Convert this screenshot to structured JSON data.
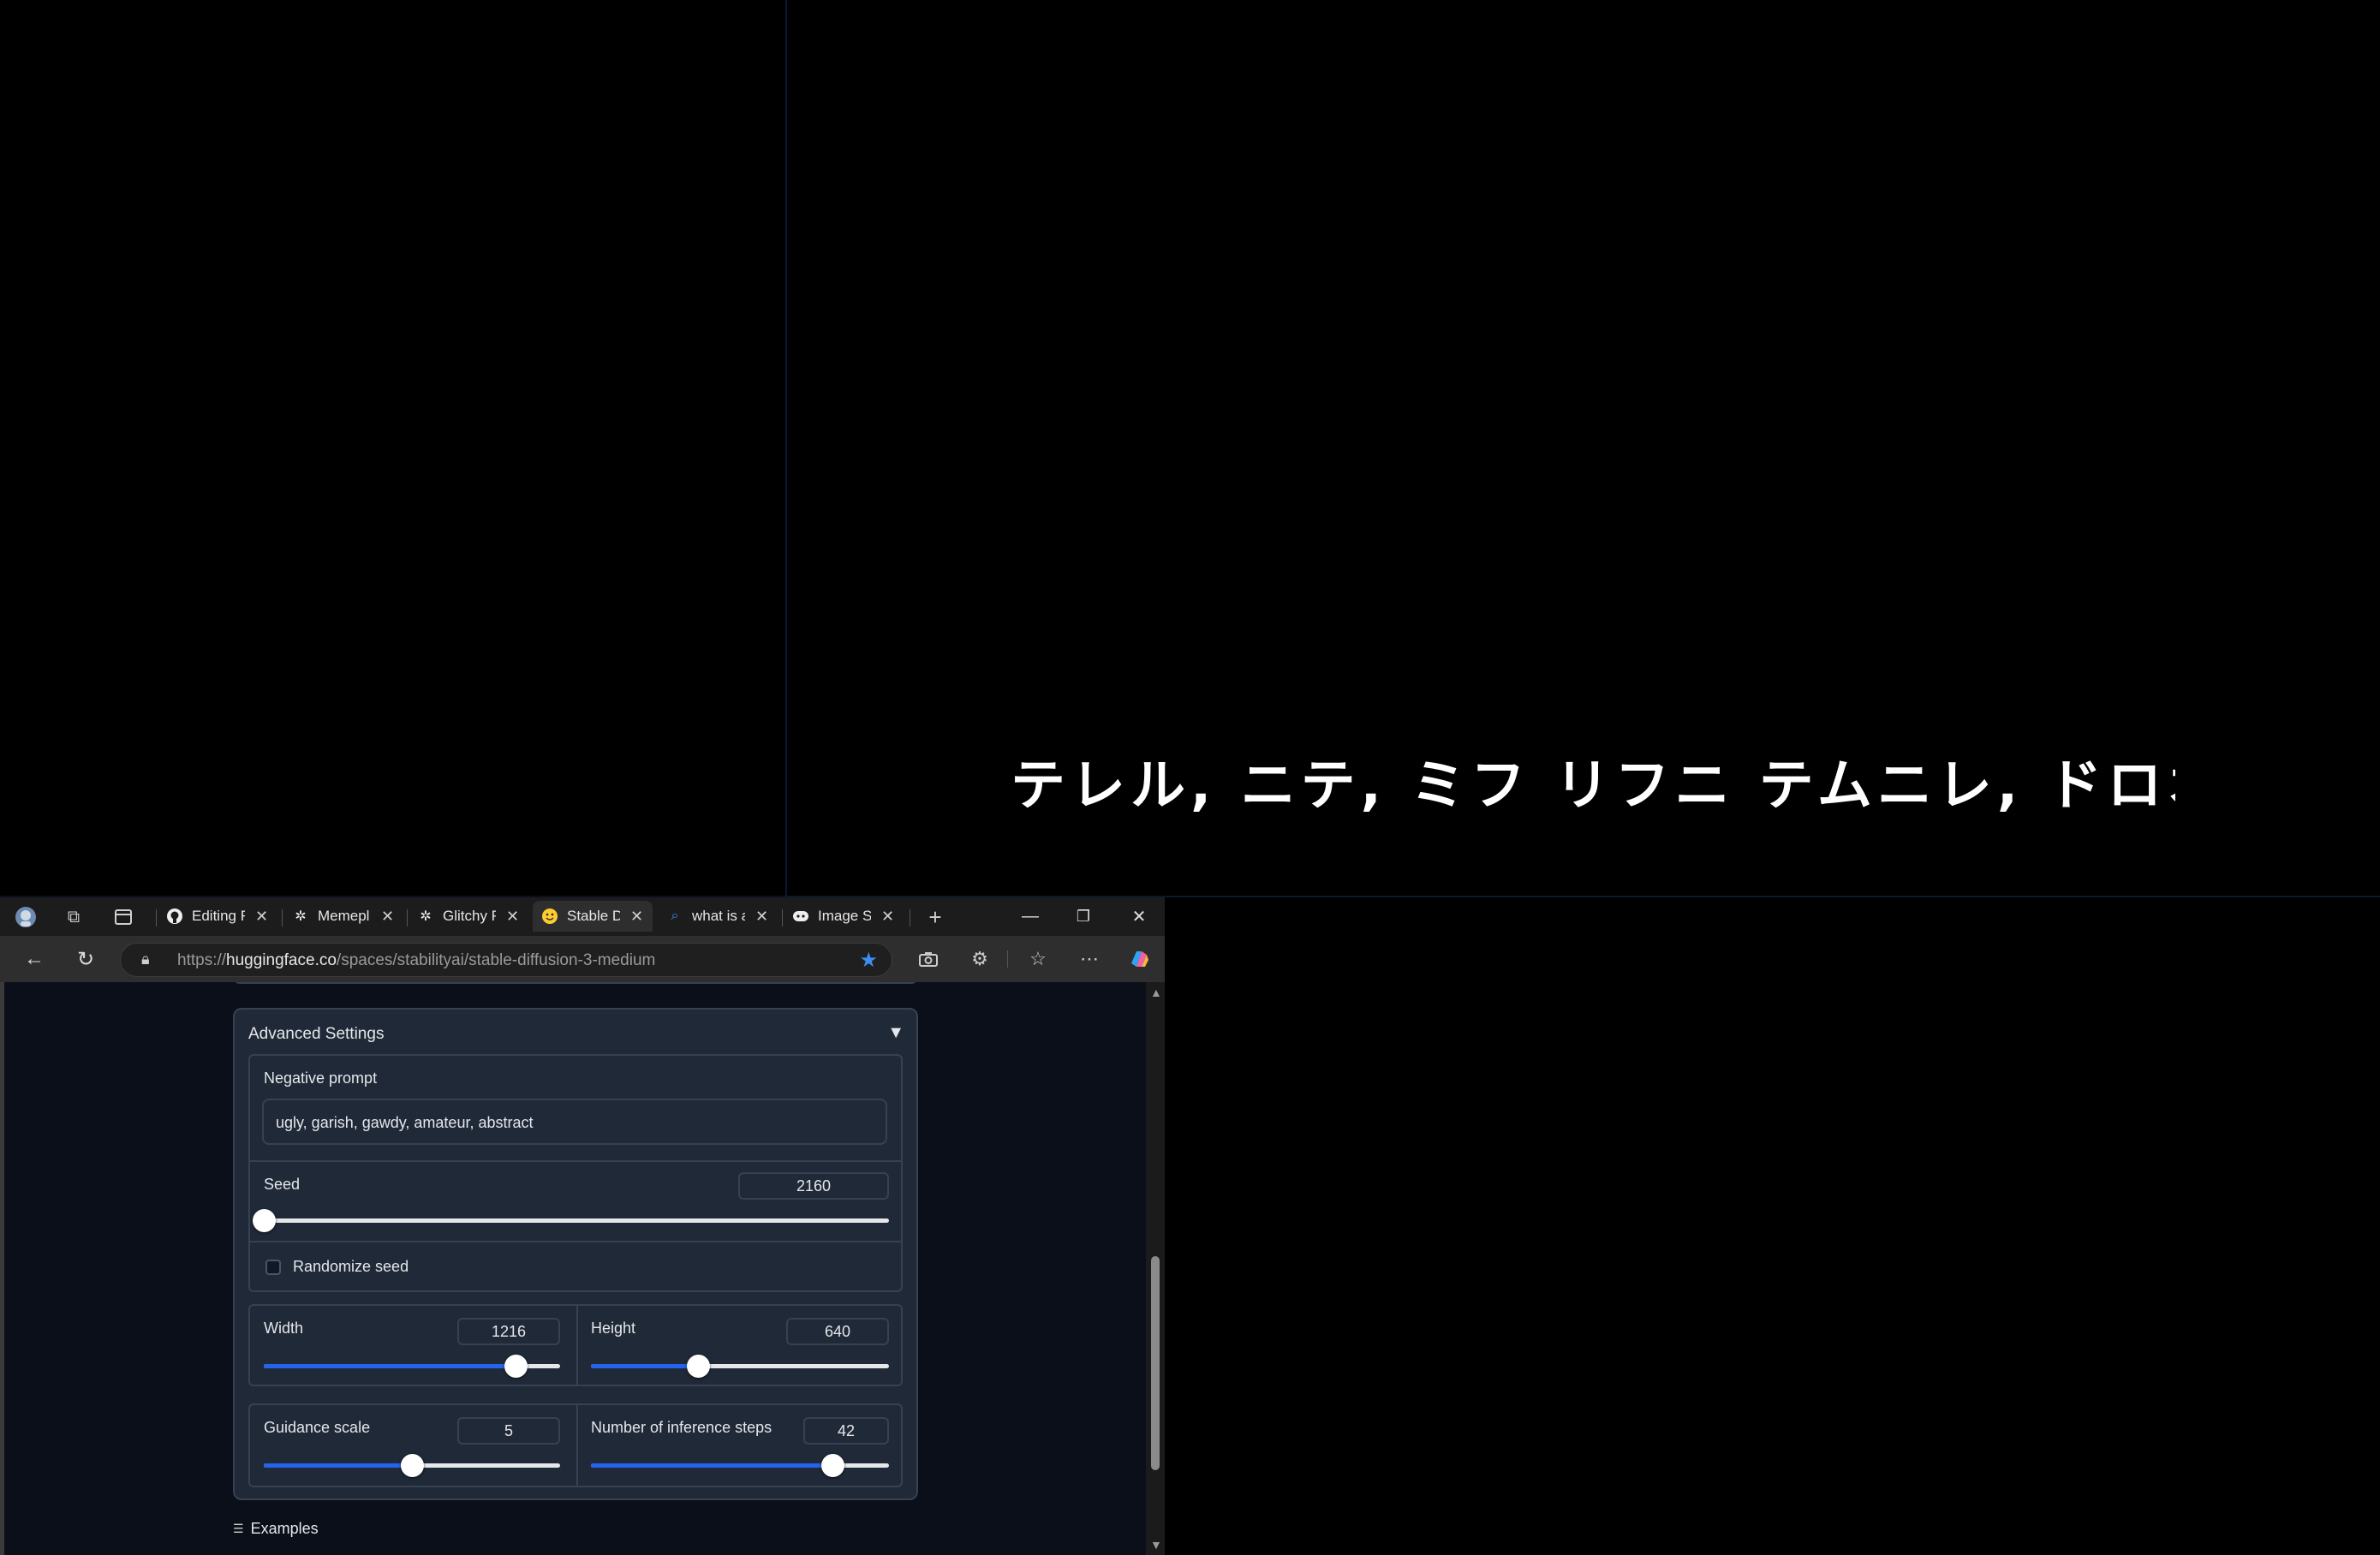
{
  "background": {
    "caption": "テレル, ニテ, ミフ リフニ テムニレ, ドロオレ, ム ムムニ リテフフレ?"
  },
  "browser": {
    "tabs": [
      {
        "title": "Editing R",
        "icon": "github-icon"
      },
      {
        "title": "Memepl",
        "icon": "openai-icon"
      },
      {
        "title": "Glitchy P",
        "icon": "openai-icon"
      },
      {
        "title": "Stable D",
        "icon": "huggingface-icon",
        "active": true
      },
      {
        "title": "what is a",
        "icon": "search-icon"
      },
      {
        "title": "Image St",
        "icon": "chatbot-icon"
      }
    ],
    "url_prefix": "https://",
    "url_host": "huggingface.co",
    "url_path": "/spaces/stabilityai/stable-diffusion-3-medium"
  },
  "settings": {
    "title": "Advanced Settings",
    "negative_prompt_label": "Negative prompt",
    "negative_prompt_value": "ugly, garish, gawdy, amateur, abstract",
    "seed_label": "Seed",
    "seed_value": "2160",
    "seed_fraction": 0.0,
    "randomize_label": "Randomize seed",
    "randomize_checked": false,
    "width_label": "Width",
    "width_value": "1216",
    "width_fraction": 0.85,
    "height_label": "Height",
    "height_value": "640",
    "height_fraction": 0.36,
    "guidance_label": "Guidance scale",
    "guidance_value": "5",
    "guidance_fraction": 0.5,
    "steps_label": "Number of inference steps",
    "steps_value": "42",
    "steps_fraction": 0.81,
    "examples_label": "Examples"
  },
  "colors": {
    "accent": "#2563eb",
    "star": "#3d8ef0",
    "page_bg": "#0b0f19",
    "panel_bg": "#1f2937"
  }
}
